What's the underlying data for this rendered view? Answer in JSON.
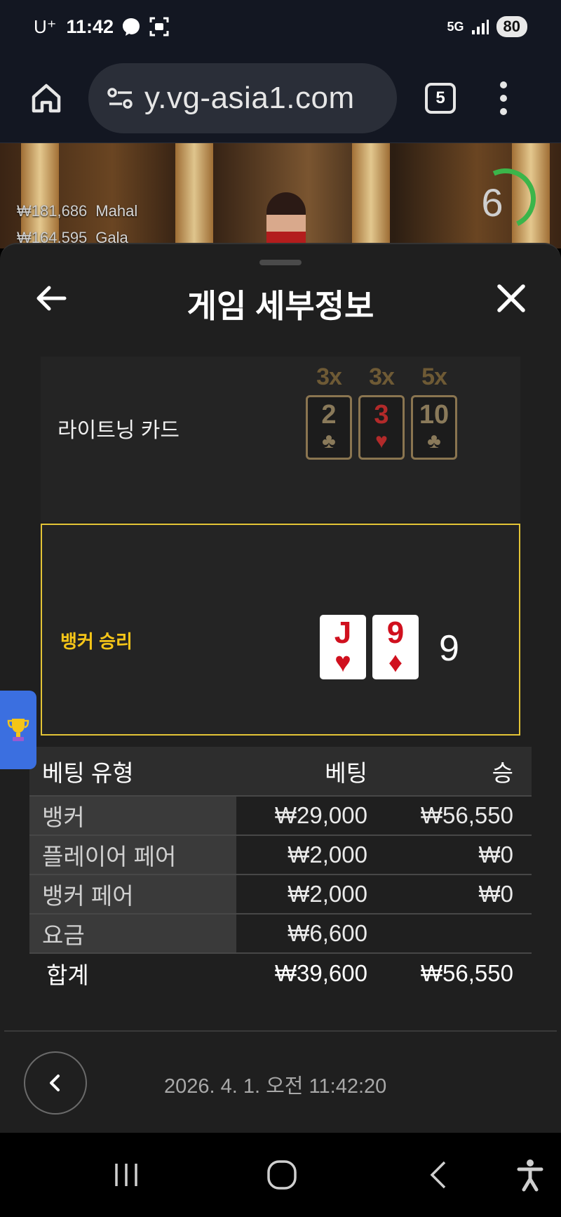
{
  "status_bar": {
    "carrier": "U⁺",
    "time": "11:42",
    "network": "5G",
    "battery": "80"
  },
  "browser": {
    "url": "y.vg-asia1.com",
    "tab_count": "5"
  },
  "game_background": {
    "winners": [
      {
        "amount": "₩181,686",
        "name": "Mahal"
      },
      {
        "amount": "₩164,595",
        "name": "Gala"
      }
    ],
    "countdown": "6"
  },
  "modal": {
    "title": "게임 세부정보",
    "lightning": {
      "label": "라이트닝 카드",
      "cards": [
        {
          "multiplier": "3x",
          "rank": "2",
          "suit": "♣",
          "color": "#8a7a5a"
        },
        {
          "multiplier": "3x",
          "rank": "3",
          "suit": "♥",
          "color": "#b22a2a"
        },
        {
          "multiplier": "5x",
          "rank": "10",
          "suit": "♣",
          "color": "#8a7a5a"
        }
      ]
    },
    "result": {
      "label": "뱅커 승리",
      "cards": [
        {
          "rank": "J",
          "suit": "♥"
        },
        {
          "rank": "9",
          "suit": "♦"
        }
      ],
      "score": "9"
    },
    "bets_table": {
      "headers": [
        "베팅 유형",
        "베팅",
        "승"
      ],
      "rows": [
        {
          "type": "뱅커",
          "bet": "₩29,000",
          "win": "₩56,550"
        },
        {
          "type": "플레이어 페어",
          "bet": "₩2,000",
          "win": "₩0"
        },
        {
          "type": "뱅커 페어",
          "bet": "₩2,000",
          "win": "₩0"
        },
        {
          "type": "요금",
          "bet": "₩6,600",
          "win": ""
        }
      ],
      "total": {
        "type": "합계",
        "bet": "₩39,600",
        "win": "₩56,550"
      }
    },
    "footer_date": "2026. 4. 1. 오전 11:42:20"
  },
  "colors": {
    "accent_yellow": "#f5c518",
    "card_red": "#d0101e",
    "timer_green": "#3bb54a",
    "trophy_tab": "#3b6fe0"
  }
}
